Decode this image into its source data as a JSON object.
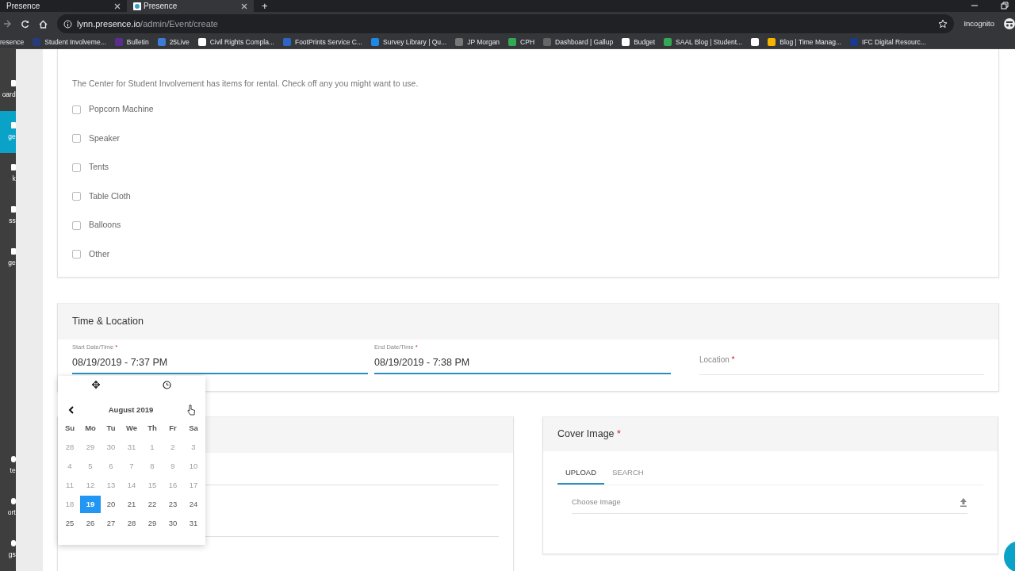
{
  "browser": {
    "tabs": [
      {
        "title": "Presence",
        "selected": false
      },
      {
        "title": "Presence",
        "selected": true
      }
    ],
    "url": {
      "host": "lynn.presence.io",
      "path": "/admin/Event/create"
    },
    "new_tab": "+",
    "profile": "Incognito",
    "bookmarks": [
      {
        "kind": "link",
        "label": "resence"
      },
      {
        "kind": "link",
        "label": "Student Involveme..."
      },
      {
        "kind": "link",
        "label": "Bulletin"
      },
      {
        "kind": "link",
        "label": "25Live"
      },
      {
        "kind": "link",
        "label": "Civil Rights Compla..."
      },
      {
        "kind": "link",
        "label": "FootPrints Service C..."
      },
      {
        "kind": "link",
        "label": "Survey Library | Qu..."
      },
      {
        "kind": "link",
        "label": "JP Morgan"
      },
      {
        "kind": "link",
        "label": "CPH"
      },
      {
        "kind": "link",
        "label": "Dashboard | Gallup"
      },
      {
        "kind": "link",
        "label": "Budget"
      },
      {
        "kind": "link",
        "label": "SAAL Blog | Student..."
      },
      {
        "kind": "icon"
      },
      {
        "kind": "link",
        "label": "Blog | Time Manag..."
      },
      {
        "kind": "link",
        "label": "IFC Digital Resourc..."
      }
    ]
  },
  "sidebar": {
    "items": [
      {
        "label": "oard",
        "selected": false
      },
      {
        "label": "ge",
        "selected": true
      },
      {
        "label": "k",
        "selected": false
      },
      {
        "label": "ss",
        "selected": false
      },
      {
        "label": "ge",
        "selected": false
      }
    ],
    "bottom_items": [
      {
        "label": "te"
      },
      {
        "label": "ort"
      },
      {
        "label": "gs"
      }
    ]
  },
  "rentals": {
    "intro": "The Center for Student Involvement has items for rental. Check off any you might want to use.",
    "items": [
      {
        "label": "Popcorn Machine",
        "checked": false
      },
      {
        "label": "Speaker",
        "checked": false
      },
      {
        "label": "Tents",
        "checked": false
      },
      {
        "label": "Table Cloth",
        "checked": false
      },
      {
        "label": "Balloons",
        "checked": false
      },
      {
        "label": "Other",
        "checked": false
      }
    ]
  },
  "time_location": {
    "title": "Time & Location",
    "start": {
      "label": "Start Date/Time",
      "required_mark": "*",
      "value": "08/19/2019 - 7:37 PM"
    },
    "end": {
      "label": "End Date/Time",
      "required_mark": "*",
      "value": "08/19/2019 - 7:38 PM"
    },
    "location": {
      "placeholder": "Location",
      "required_mark": "*"
    }
  },
  "datepicker": {
    "month": "August 2019",
    "weekdays": [
      "Su",
      "Mo",
      "Tu",
      "We",
      "Th",
      "Fr",
      "Sa"
    ],
    "weeks": [
      [
        {
          "day": "28",
          "disabled": true,
          "selected": false
        },
        {
          "day": "29",
          "disabled": true,
          "selected": false
        },
        {
          "day": "30",
          "disabled": true,
          "selected": false
        },
        {
          "day": "31",
          "disabled": true,
          "selected": false
        },
        {
          "day": "1",
          "disabled": true,
          "selected": false
        },
        {
          "day": "2",
          "disabled": true,
          "selected": false
        },
        {
          "day": "3",
          "disabled": true,
          "selected": false
        }
      ],
      [
        {
          "day": "4",
          "disabled": true,
          "selected": false
        },
        {
          "day": "5",
          "disabled": true,
          "selected": false
        },
        {
          "day": "6",
          "disabled": true,
          "selected": false
        },
        {
          "day": "7",
          "disabled": true,
          "selected": false
        },
        {
          "day": "8",
          "disabled": true,
          "selected": false
        },
        {
          "day": "9",
          "disabled": true,
          "selected": false
        },
        {
          "day": "10",
          "disabled": true,
          "selected": false
        }
      ],
      [
        {
          "day": "11",
          "disabled": true,
          "selected": false
        },
        {
          "day": "12",
          "disabled": true,
          "selected": false
        },
        {
          "day": "13",
          "disabled": true,
          "selected": false
        },
        {
          "day": "14",
          "disabled": true,
          "selected": false
        },
        {
          "day": "15",
          "disabled": true,
          "selected": false
        },
        {
          "day": "16",
          "disabled": true,
          "selected": false
        },
        {
          "day": "17",
          "disabled": true,
          "selected": false
        }
      ],
      [
        {
          "day": "18",
          "disabled": true,
          "selected": false
        },
        {
          "day": "19",
          "disabled": false,
          "selected": true
        },
        {
          "day": "20",
          "disabled": false,
          "selected": false
        },
        {
          "day": "21",
          "disabled": false,
          "selected": false
        },
        {
          "day": "22",
          "disabled": false,
          "selected": false
        },
        {
          "day": "23",
          "disabled": false,
          "selected": false
        },
        {
          "day": "24",
          "disabled": false,
          "selected": false
        }
      ],
      [
        {
          "day": "25",
          "disabled": false,
          "selected": false
        },
        {
          "day": "26",
          "disabled": false,
          "selected": false
        },
        {
          "day": "27",
          "disabled": false,
          "selected": false
        },
        {
          "day": "28",
          "disabled": false,
          "selected": false
        },
        {
          "day": "29",
          "disabled": false,
          "selected": false
        },
        {
          "day": "30",
          "disabled": false,
          "selected": false
        },
        {
          "day": "31",
          "disabled": false,
          "selected": false
        }
      ]
    ]
  },
  "cover_image": {
    "title": "Cover Image",
    "required_mark": "*",
    "tabs": [
      {
        "label": "UPLOAD",
        "selected": true
      },
      {
        "label": "SEARCH",
        "selected": false
      }
    ],
    "field": {
      "placeholder": "Choose Image"
    }
  }
}
